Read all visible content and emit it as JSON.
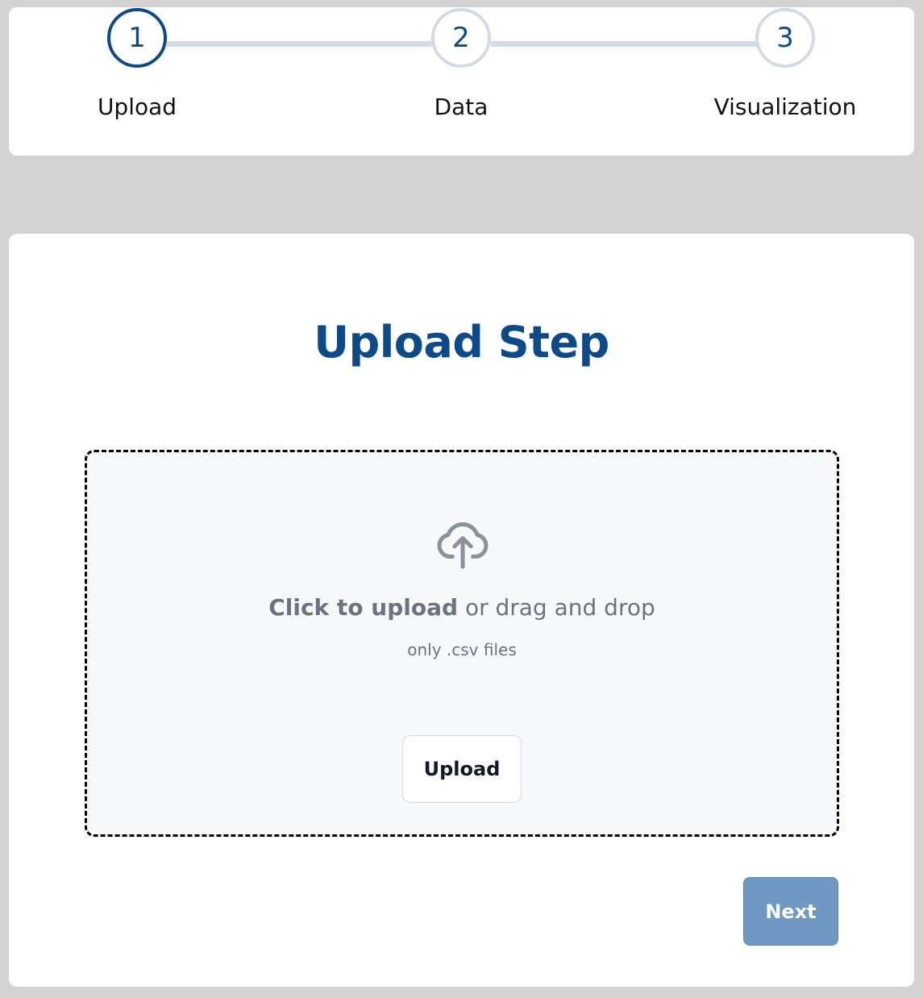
{
  "stepper": {
    "steps": [
      {
        "number": "1",
        "label": "Upload",
        "active": true
      },
      {
        "number": "2",
        "label": "Data",
        "active": false
      },
      {
        "number": "3",
        "label": "Visualization",
        "active": false
      }
    ]
  },
  "main": {
    "title": "Upload Step",
    "dropzone": {
      "icon": "cloud-upload-icon",
      "click_text": "Click to upload",
      "drag_text": " or drag and drop",
      "hint": "only .csv files",
      "upload_button_label": "Upload"
    },
    "next_button_label": "Next"
  },
  "colors": {
    "background": "#d3d3d3",
    "accent": "#0c4a89",
    "inactive_step": "#d2dbe6",
    "next_button": "#6f98c2",
    "muted_text": "#6b7280"
  }
}
